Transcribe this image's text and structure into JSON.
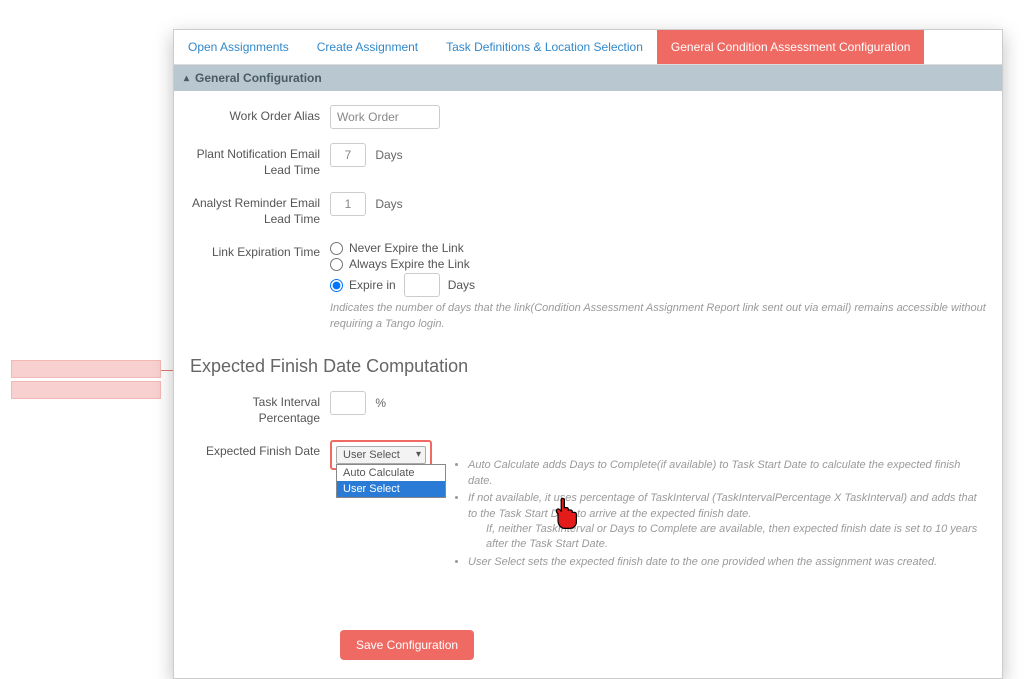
{
  "tabs": [
    {
      "label": "Open Assignments"
    },
    {
      "label": "Create Assignment"
    },
    {
      "label": "Task Definitions & Location Selection"
    },
    {
      "label": "General Condition Assessment Configuration",
      "active": true
    }
  ],
  "accordion": {
    "title": "General Configuration"
  },
  "fields": {
    "work_order_alias": {
      "label": "Work Order Alias",
      "value": "Work Order"
    },
    "plant_notification": {
      "label": "Plant Notification Email Lead Time",
      "value": "7",
      "unit": "Days"
    },
    "analyst_reminder": {
      "label": "Analyst Reminder Email Lead Time",
      "value": "1",
      "unit": "Days"
    },
    "link_expiration": {
      "label": "Link Expiration Time",
      "options": {
        "never": "Never Expire the Link",
        "always": "Always Expire the Link",
        "expire_in": "Expire in",
        "expire_unit": "Days"
      },
      "selected": "expire_in",
      "help": "Indicates the number of days that the link(Condition Assessment Assignment Report link sent out via email) remains accessible without requiring a Tango login."
    },
    "section_title": "Expected Finish Date Computation",
    "task_interval_pct": {
      "label": "Task Interval Percentage",
      "unit": "%",
      "value": ""
    },
    "expected_finish_date": {
      "label": "Expected Finish Date",
      "selected": "User Select",
      "options": [
        "Auto Calculate",
        "User Select"
      ],
      "help_bullets": [
        "Auto Calculate adds Days to Complete(if available) to Task Start Date to calculate the expected finish date.",
        "If not available, it uses percentage of TaskInterval (TaskIntervalPercentage X TaskInterval) and adds that to the Task Start Date to arrive at the expected finish date.",
        "If, neither TaskInterval or Days to Complete are available, then expected finish date is set to 10 years after the Task Start Date.",
        "User Select sets the expected finish date to the one provided when the assignment was created."
      ]
    }
  },
  "save_button": "Save Configuration"
}
